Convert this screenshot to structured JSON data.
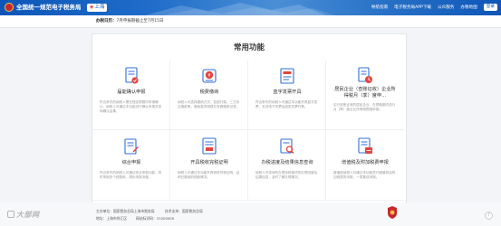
{
  "header": {
    "site_title": "全国统一规范电子税务局",
    "region_pin": "◉",
    "region": "上海",
    "nav": [
      "导航指南",
      "电子税务局APP下载",
      "公众服务",
      "办税地图",
      "登录"
    ]
  },
  "notice": {
    "label": "办税日历：",
    "text": "7月申报期截止至7月15日"
  },
  "main": {
    "title": "常用功能",
    "cards": [
      {
        "title": "届能确认申报",
        "desc": "符合条件的纳税人需在规定期限内申请确认，纳税人可通过本功能进行确认申报并查询确认结果。"
      },
      {
        "title": "税费缴纳",
        "desc": "纳税人可选择缴纳方式，如银行端、三方协议缴款等，缴纳各项税费并查看缴款记录。"
      },
      {
        "title": "蓝字发票开具",
        "desc": "符合条件的纳税人可通过本功能开具蓝字发票，支持电子发票及纸质发票开具。"
      },
      {
        "title": "居民企业（查账征收）企业所得税月（季）度申…",
        "desc": "实行查账征收的居民企业，在预缴期内进行月（季）度企业所得税预缴申报。"
      },
      {
        "title": "综合申报",
        "desc": "符合条件的纳税人可通过综合申报功能，同时申报多个税费种，简化申报流程。"
      },
      {
        "title": "开具税收完税证明",
        "desc": "纳税人可通过本功能开具税收完税证明，证明已缴纳的税款情况。"
      },
      {
        "title": "办税进度及结果信息查询",
        "desc": "纳税人可查询所办理涉税事项的办理进度及结果信息，及时了解办理情况。"
      },
      {
        "title": "增值税及附加税费申报",
        "desc": "增值税纳税人可通过本功能进行增值税及附加税费的申报，一表集成申报。"
      }
    ]
  },
  "footer": {
    "line1": "主办单位：国家税务总局上海市税务局",
    "line1b": "技术支持：国家税务总局",
    "line2": "地址：上海市徐汇区",
    "line2b": "网站标识码：31000000",
    "watermark": "大部网"
  },
  "colors": {
    "header_blue": "#0d56b8",
    "icon_blue": "#2f6fd6",
    "icon_red": "#e0463f"
  }
}
